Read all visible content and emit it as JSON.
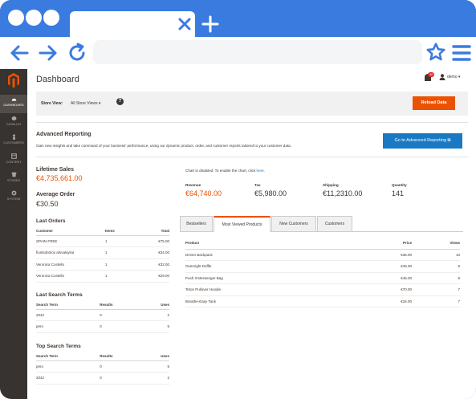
{
  "colors": {
    "browser_accent": "#3a7be0",
    "brand_orange": "#eb5202",
    "link_blue": "#1979c3",
    "sidebar_bg": "#373330"
  },
  "sidebar": {
    "items": [
      {
        "label": "DASHBOARD",
        "icon": "dashboard-icon"
      },
      {
        "label": "CATALOG",
        "icon": "catalog-icon"
      },
      {
        "label": "CUSTOMERS",
        "icon": "customers-icon"
      },
      {
        "label": "CONTENT",
        "icon": "content-icon"
      },
      {
        "label": "STORES",
        "icon": "stores-icon"
      },
      {
        "label": "SYSTEM",
        "icon": "system-icon"
      }
    ]
  },
  "header": {
    "title": "Dashboard",
    "notification_count": "40",
    "user": "demo"
  },
  "store": {
    "label": "Store View:",
    "value": "All Store Views",
    "reload_label": "Reload Data"
  },
  "advanced": {
    "title": "Advanced Reporting",
    "text": "Gain new insights and take command of your business' performance, using our dynamic product, order, and customer reports tailored to your customer data.",
    "button": "Go to Advanced Reporting"
  },
  "stats": {
    "lifetime_label": "Lifetime Sales",
    "lifetime_value": "€4,735,661.00",
    "avg_label": "Average Order",
    "avg_value": "€30.50"
  },
  "last_orders": {
    "title": "Last Orders",
    "headers": [
      "Customer",
      "Items",
      "Total"
    ],
    "rows": [
      [
        "SPAIN FREE",
        "1",
        "€75.00"
      ],
      [
        "fionlsdntiros alnvalsylsa",
        "1",
        "€34.00"
      ],
      [
        "Veronica Costello",
        "1",
        "€32.00"
      ],
      [
        "Veronica Costello",
        "1",
        "€29.00"
      ]
    ]
  },
  "last_search": {
    "title": "Last Search Terms",
    "headers": [
      "Search Term",
      "Results",
      "Uses"
    ],
    "rows": [
      [
        "2042",
        "0",
        "2"
      ],
      [
        "pero",
        "0",
        "5"
      ]
    ]
  },
  "top_search": {
    "title": "Top Search Terms",
    "headers": [
      "Search Term",
      "Results",
      "Uses"
    ],
    "rows": [
      [
        "pero",
        "0",
        "5"
      ],
      [
        "2042",
        "0",
        "2"
      ]
    ]
  },
  "chart": {
    "message": "Chart is disabled. To enable the chart, click ",
    "link": "here."
  },
  "totals": [
    {
      "label": "Revenue",
      "value": "€64,740.00"
    },
    {
      "label": "Tax",
      "value": "€5,980.00"
    },
    {
      "label": "Shipping",
      "value": "€11,2310.00"
    },
    {
      "label": "Quantity",
      "value": "141"
    }
  ],
  "tabs": [
    "Bestsellers",
    "Most Viewed Products",
    "New Customers",
    "Customers"
  ],
  "products": {
    "headers": [
      "Product",
      "Price",
      "Views"
    ],
    "rows": [
      [
        "Driven Backpack",
        "€36.00",
        "10"
      ],
      [
        "Overnight Duffle",
        "€45.00",
        "9"
      ],
      [
        "Push It Messenger Bag",
        "€45.00",
        "9"
      ],
      [
        "Teton Pullover Hoodie",
        "€70.00",
        "7"
      ],
      [
        "Breathe-Easy Tank",
        "€34.00",
        "7"
      ]
    ]
  }
}
